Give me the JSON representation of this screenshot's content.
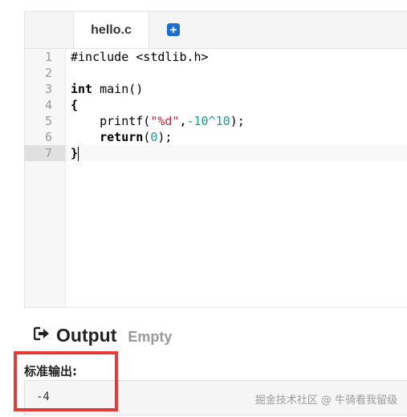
{
  "editor": {
    "tab_label": "hello.c",
    "add_tab_label": "+",
    "line_numbers": [
      "1",
      "2",
      "3",
      "4",
      "5",
      "6",
      "7"
    ],
    "code": {
      "l1": "#include <stdlib.h>",
      "l3_kw": "int",
      "l3_rest": " main()",
      "l4": "{",
      "l5_indent": "    ",
      "l5_fn": "printf(",
      "l5_str": "\"%d\"",
      "l5_comma": ",",
      "l5_num": "-10^10",
      "l5_end": ");",
      "l6_indent": "    ",
      "l6_kw": "return",
      "l6_open": "(",
      "l6_num": "0",
      "l6_end": ");",
      "l7": "}"
    },
    "active_line": 7
  },
  "output": {
    "icon": "sign-out-icon",
    "title": "Output",
    "status": "Empty",
    "stdout_label": "标准输出:",
    "stdout_value": "-4"
  },
  "watermark": "掘金技术社区 @ 牛骑看我留级",
  "colors": {
    "highlight_box": "#e53935",
    "accent": "#1e6fc9",
    "string": "#c22a3c",
    "number": "#1a9b8c"
  }
}
